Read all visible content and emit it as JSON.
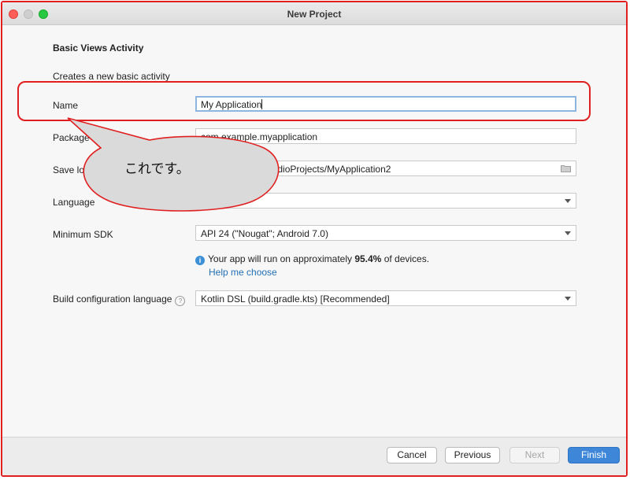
{
  "window": {
    "title": "New Project"
  },
  "page": {
    "heading": "Basic Views Activity",
    "subheading": "Creates a new basic activity"
  },
  "form": {
    "name": {
      "label": "Name",
      "value": "My Application"
    },
    "package": {
      "label": "Package name",
      "value": "com.example.myapplication"
    },
    "save_location": {
      "label": "Save location",
      "value": "/Users/AndroidStudioProjects/MyApplication2"
    },
    "language": {
      "label": "Language",
      "value": "Kotlin"
    },
    "min_sdk": {
      "label": "Minimum SDK",
      "value": "API 24 (\"Nougat\"; Android 7.0)"
    },
    "info": {
      "prefix": "Your app will run on approximately ",
      "percent": "95.4%",
      "suffix": " of devices."
    },
    "help_link": "Help me choose",
    "build_lang": {
      "label": "Build configuration language",
      "value": "Kotlin DSL (build.gradle.kts) [Recommended]"
    }
  },
  "footer": {
    "cancel": "Cancel",
    "previous": "Previous",
    "next": "Next",
    "finish": "Finish"
  },
  "annotation": {
    "callout": "これです。"
  },
  "icons": {
    "info": "info-icon",
    "help": "help-icon",
    "folder": "folder-icon",
    "dropdown": "chevron-down-icon"
  },
  "colors": {
    "annotation": "#e02020",
    "primary_button": "#3e86d8",
    "link": "#2470b3"
  }
}
